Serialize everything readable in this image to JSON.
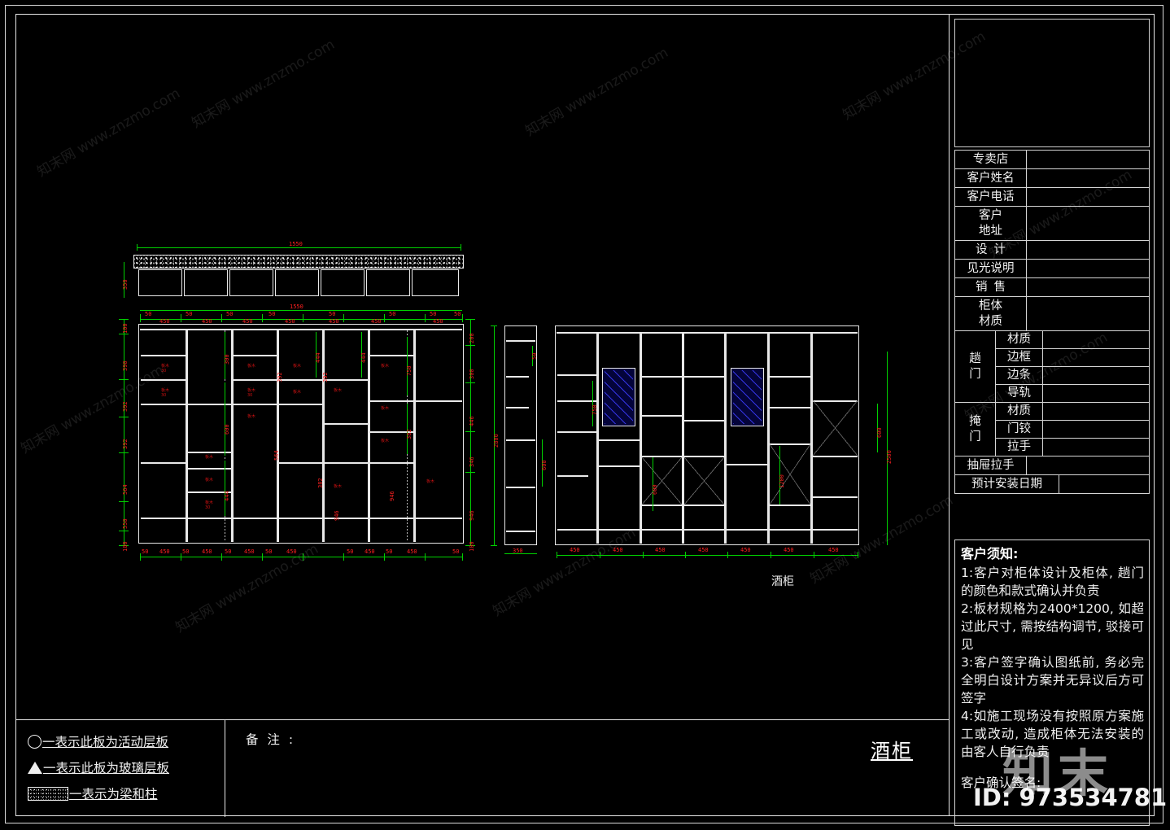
{
  "sheet": {
    "title": "酒柜",
    "cabinet_label": "酒柜",
    "watermark_text": "知末网 www.znzmo.com",
    "watermark_logo": "知末",
    "watermark_id": "ID: 973534781"
  },
  "title_block": {
    "rows": [
      {
        "label": "专卖店",
        "value": "",
        "spaced": false
      },
      {
        "label": "客户姓名",
        "value": "",
        "spaced": false
      },
      {
        "label": "客户电话",
        "value": "",
        "spaced": false
      },
      {
        "label": "客户\n地址",
        "value": "",
        "two_line": true,
        "line1": "客户",
        "line2": "地址"
      },
      {
        "label": "设 计",
        "value": "",
        "spaced": true,
        "text": "设计"
      },
      {
        "label": "见光说明",
        "value": "",
        "spaced": false
      },
      {
        "label": "销 售",
        "value": "",
        "spaced": true,
        "text": "销售"
      },
      {
        "label": "柜体\n材质",
        "value": "",
        "two_line": true,
        "line1": "柜体",
        "line2": "材质"
      }
    ],
    "groups": [
      {
        "name_l1": "趟",
        "name_l2": "门",
        "subrows": [
          {
            "label": "材质",
            "value": ""
          },
          {
            "label": "边框",
            "value": ""
          },
          {
            "label": "边条",
            "value": ""
          },
          {
            "label": "导轨",
            "value": ""
          }
        ]
      },
      {
        "name_l1": "掩",
        "name_l2": "门",
        "subrows": [
          {
            "label": "材质",
            "value": ""
          },
          {
            "label": "门铰",
            "value": ""
          },
          {
            "label": "拉手",
            "value": ""
          }
        ]
      }
    ],
    "tail_rows": [
      {
        "label": "抽屉拉手",
        "value": ""
      },
      {
        "label": "预计安装日期",
        "value": ""
      }
    ]
  },
  "notes": {
    "title": "客户须知:",
    "items": [
      "1:客户对柜体设计及柜体, 趟门的颜色和款式确认并负责",
      "2:板材规格为2400*1200, 如超过此尺寸, 需按结构调节, 驳接可见",
      "3:客户签字确认图纸前, 务必完全明白设计方案并无异议后方可签字",
      "4:如施工现场没有按照原方案施工或改动, 造成柜体无法安装的由客人自行负责"
    ],
    "signature_label": "客户确认签名:"
  },
  "legend": {
    "items": [
      {
        "symbol": "circle",
        "text": "一表示此板为活动层板"
      },
      {
        "symbol": "triangle",
        "text": "一表示此板为玻璃层板"
      },
      {
        "symbol": "hatch",
        "text": "一表示为梁和柱"
      }
    ],
    "remark_label": "备 注 :"
  },
  "drawing": {
    "plan_view": {
      "name": "top-plan-view",
      "overall_width": "1550",
      "height": "350",
      "bays": 7
    },
    "front_elevation": {
      "name": "front-elevation",
      "overall_width": "1550",
      "top_dims": [
        "50",
        "450",
        "50",
        "450",
        "50",
        "450",
        "50",
        "450",
        "50",
        "450",
        "50"
      ],
      "bottom_dims": [
        "50",
        "450",
        "50",
        "450",
        "50",
        "450",
        "50",
        "450",
        "50",
        "450",
        "50"
      ],
      "left_dims": [
        "100",
        "390",
        "392",
        "392",
        "564",
        "550",
        "100"
      ],
      "right_dims": [
        "200",
        "300",
        "446",
        "346",
        "946",
        "100"
      ],
      "inner_labels": [
        "300",
        "600",
        "444",
        "392",
        "400",
        "750",
        "382",
        "564",
        "946",
        "428",
        "350"
      ]
    },
    "side_elevation": {
      "name": "side-section-view",
      "height": "2800",
      "depth": "350",
      "dims": [
        "50",
        "600"
      ]
    },
    "right_elevation": {
      "name": "right-elevation",
      "bottom_dims": [
        "450",
        "450",
        "450",
        "450",
        "450",
        "450",
        "450"
      ],
      "right_dims": [
        "600",
        "2500"
      ],
      "inner_labels": [
        "750",
        "600",
        "1200"
      ],
      "glass_panels": 2
    }
  },
  "colors": {
    "background": "#000000",
    "line": "#e9e9e9",
    "dimension_line": "#00d000",
    "dimension_text": "#ff2020",
    "glass": "#04043a"
  }
}
